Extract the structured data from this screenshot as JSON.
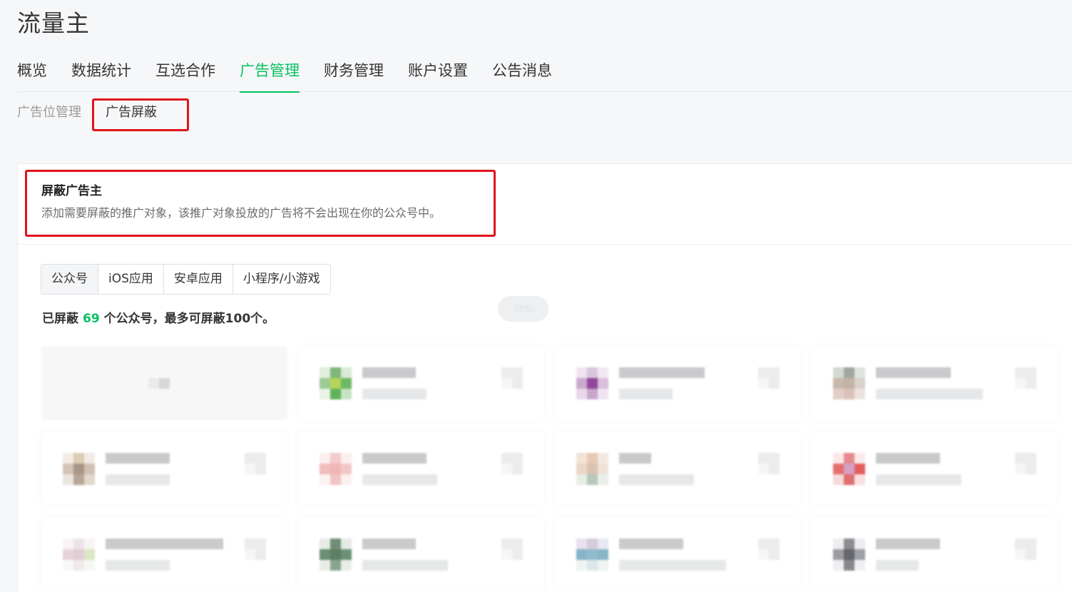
{
  "app_title": "流量主",
  "main_tabs": [
    {
      "label": "概览",
      "active": false
    },
    {
      "label": "数据统计",
      "active": false
    },
    {
      "label": "互选合作",
      "active": false
    },
    {
      "label": "广告管理",
      "active": true
    },
    {
      "label": "财务管理",
      "active": false
    },
    {
      "label": "账户设置",
      "active": false
    },
    {
      "label": "公告消息",
      "active": false
    }
  ],
  "sub_tabs": [
    {
      "label": "广告位管理",
      "active": false
    },
    {
      "label": "广告屏蔽",
      "active": true
    }
  ],
  "section": {
    "title": "屏蔽广告主",
    "description": "添加需要屏蔽的推广对象，该推广对象投放的广告将不会出现在你的公众号中。"
  },
  "type_tabs": [
    {
      "label": "公众号",
      "active": true
    },
    {
      "label": "iOS应用",
      "active": false
    },
    {
      "label": "安卓应用",
      "active": false
    },
    {
      "label": "小程序/小游戏",
      "active": false
    }
  ],
  "blocked_summary": {
    "prefix": "已屏蔽",
    "count": "69",
    "suffix": "个公众号，最多可屏蔽100个。"
  },
  "progress_badge": "70%",
  "colors": {
    "accent_green": "#07c160",
    "highlight_red": "#e0121b"
  }
}
